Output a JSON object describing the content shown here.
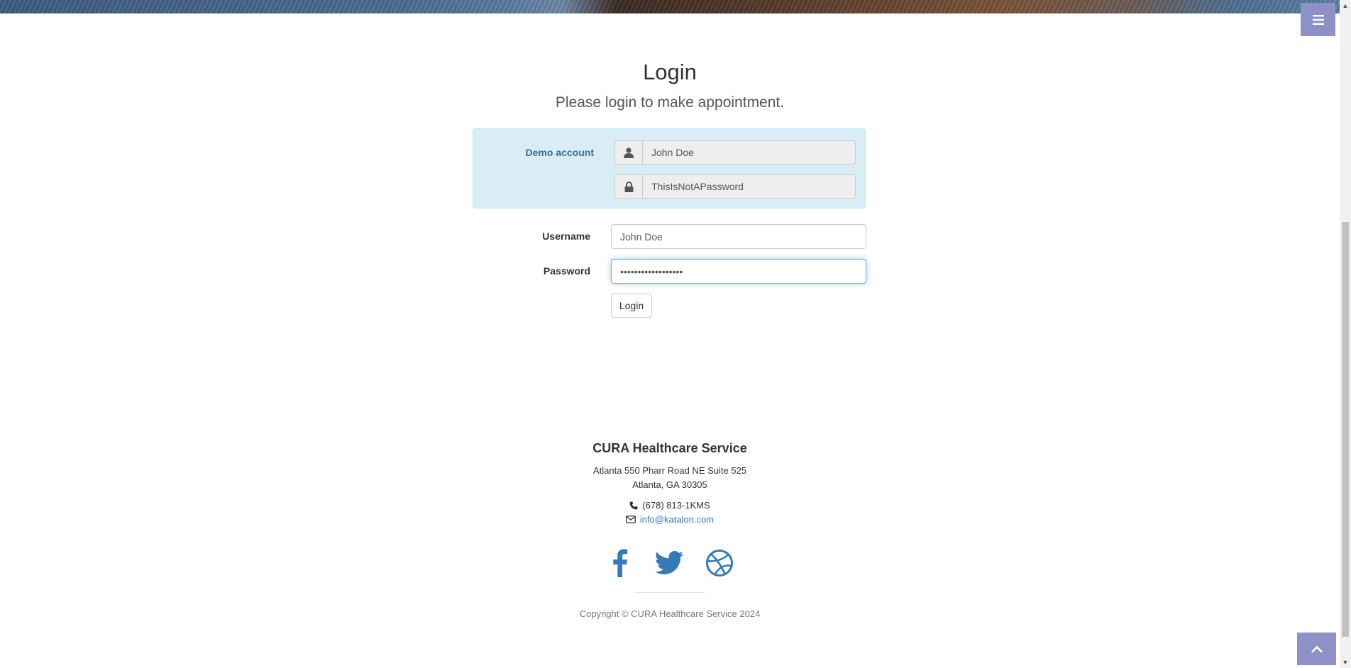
{
  "header": {
    "menu_icon": "bars-icon"
  },
  "login": {
    "title": "Login",
    "subtitle": "Please login to make appointment.",
    "demo": {
      "label": "Demo account",
      "username_icon": "user-icon",
      "username_value": "John Doe",
      "password_icon": "lock-icon",
      "password_value": "ThisIsNotAPassword"
    },
    "username_label": "Username",
    "username_value": "John Doe",
    "password_label": "Password",
    "password_value": "ThisIsNotAPassword",
    "button_label": "Login"
  },
  "footer": {
    "title": "CURA Healthcare Service",
    "address_line1": "Atlanta 550 Pharr Road NE Suite 525",
    "address_line2": "Atlanta, GA 30305",
    "phone": "(678) 813-1KMS",
    "email": "info@katalon.com",
    "social": [
      "facebook-icon",
      "twitter-icon",
      "dribbble-icon"
    ],
    "copyright": "Copyright © CURA Healthcare Service 2024"
  },
  "colors": {
    "accent": "#8e91c7",
    "demo_bg": "#d9edf7",
    "demo_label": "#31708f",
    "link": "#337ab7"
  }
}
